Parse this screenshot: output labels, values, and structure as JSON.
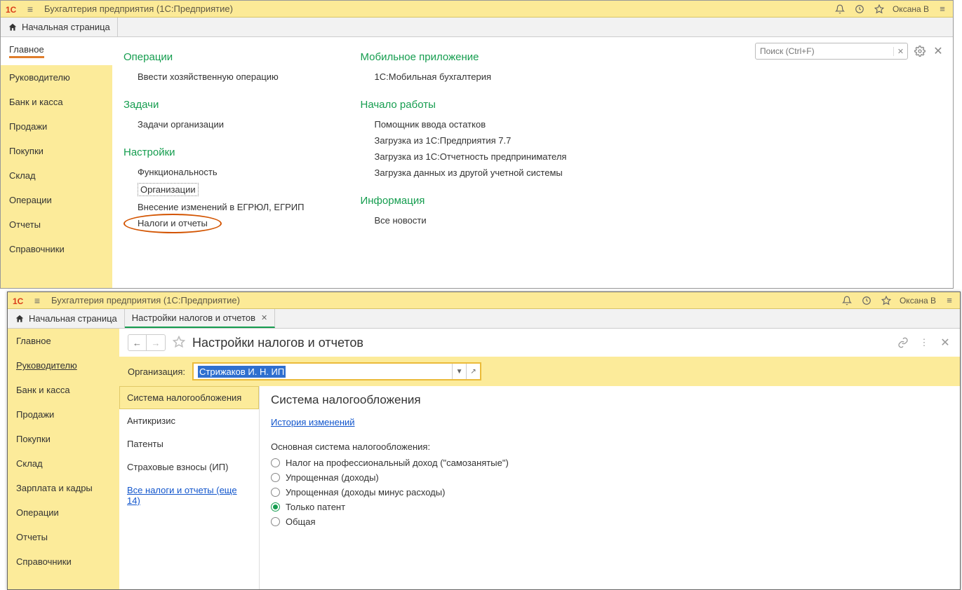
{
  "app": {
    "title": "Бухгалтерия предприятия  (1С:Предприятие)",
    "user": "Оксана В"
  },
  "tabs": {
    "home": "Начальная страница",
    "doc": "Настройки налогов и отчетов"
  },
  "sidebar1": [
    "Главное",
    "Руководителю",
    "Банк и касса",
    "Продажи",
    "Покупки",
    "Склад",
    "Операции",
    "Отчеты",
    "Справочники"
  ],
  "sidebar2": [
    "Главное",
    "Руководителю",
    "Банк и касса",
    "Продажи",
    "Покупки",
    "Склад",
    "Зарплата и кадры",
    "Операции",
    "Отчеты",
    "Справочники"
  ],
  "search": {
    "placeholder": "Поиск (Ctrl+F)"
  },
  "menu": {
    "col1": {
      "s1": "Операции",
      "s1_i1": "Ввести хозяйственную операцию",
      "s2": "Задачи",
      "s2_i1": "Задачи организации",
      "s3": "Настройки",
      "s3_i1": "Функциональность",
      "s3_i2": "Организации",
      "s3_i3": "Внесение изменений в ЕГРЮЛ, ЕГРИП",
      "s3_i4": "Налоги и отчеты"
    },
    "col2": {
      "s1": "Мобильное приложение",
      "s1_i1": "1С:Мобильная бухгалтерия",
      "s2": "Начало работы",
      "s2_i1": "Помощник ввода остатков",
      "s2_i2": "Загрузка из 1С:Предприятия 7.7",
      "s2_i3": "Загрузка из 1С:Отчетность предпринимателя",
      "s2_i4": "Загрузка данных из другой учетной системы",
      "s3": "Информация",
      "s3_i1": "Все новости"
    }
  },
  "page2": {
    "title": "Настройки налогов и отчетов",
    "org_label": "Организация:",
    "org_value": "Стрижаков И. Н. ИП",
    "tax_tabs": {
      "t1": "Система налогообложения",
      "t2": "Антикризис",
      "t3": "Патенты",
      "t4": "Страховые взносы (ИП)",
      "t5": "Все налоги и отчеты (еще 14)"
    },
    "heading": "Система налогообложения",
    "history": "История изменений",
    "radio_label": "Основная система налогообложения:",
    "r1": "Налог на профессиональный доход (\"самозанятые\")",
    "r2": "Упрощенная (доходы)",
    "r3": "Упрощенная (доходы минус расходы)",
    "r4": "Только патент",
    "r5": "Общая"
  }
}
